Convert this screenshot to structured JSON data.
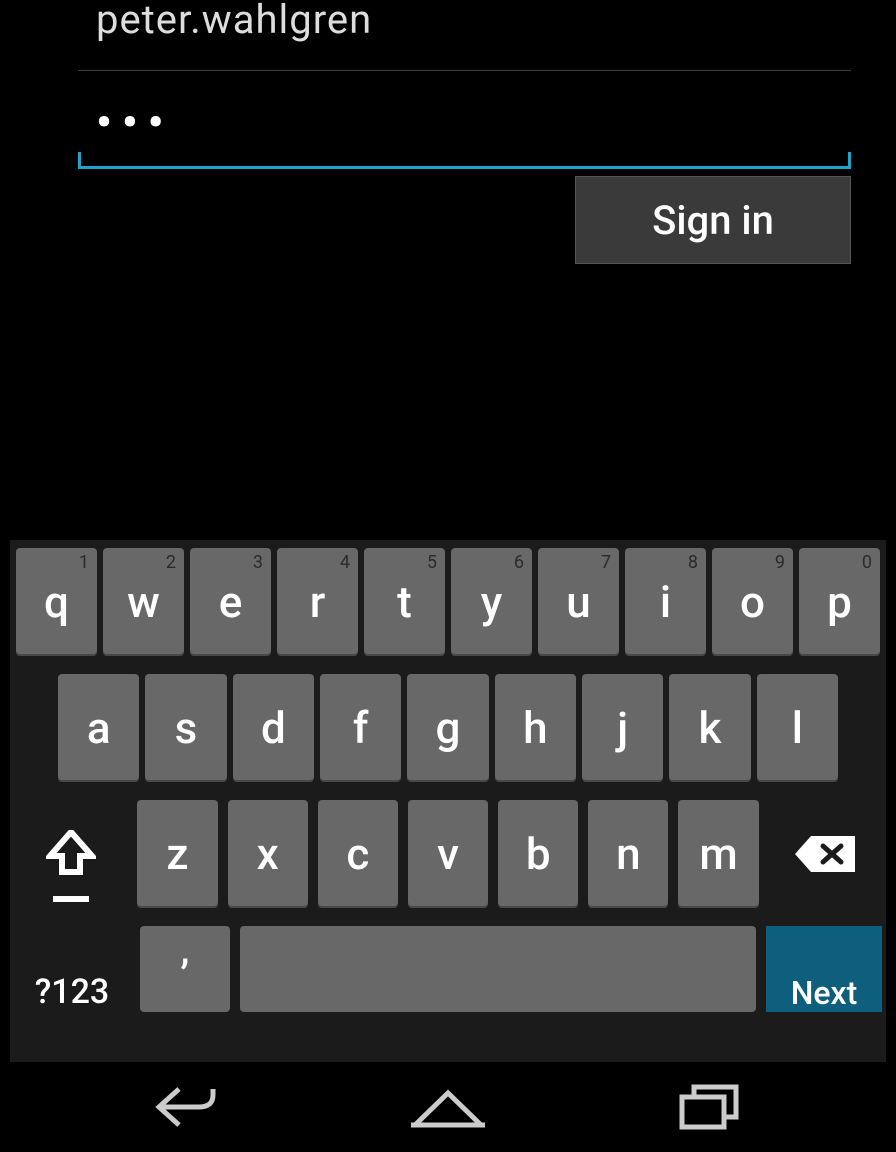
{
  "form": {
    "username_value": "peter.wahlgren",
    "password_masked": "•••",
    "signin_label": "Sign in"
  },
  "keyboard": {
    "row1": [
      {
        "label": "q",
        "sup": "1"
      },
      {
        "label": "w",
        "sup": "2"
      },
      {
        "label": "e",
        "sup": "3"
      },
      {
        "label": "r",
        "sup": "4"
      },
      {
        "label": "t",
        "sup": "5"
      },
      {
        "label": "y",
        "sup": "6"
      },
      {
        "label": "u",
        "sup": "7"
      },
      {
        "label": "i",
        "sup": "8"
      },
      {
        "label": "o",
        "sup": "9"
      },
      {
        "label": "p",
        "sup": "0"
      }
    ],
    "row2": [
      {
        "label": "a"
      },
      {
        "label": "s"
      },
      {
        "label": "d"
      },
      {
        "label": "f"
      },
      {
        "label": "g"
      },
      {
        "label": "h"
      },
      {
        "label": "j"
      },
      {
        "label": "k"
      },
      {
        "label": "l"
      }
    ],
    "row3": [
      {
        "label": "z"
      },
      {
        "label": "x"
      },
      {
        "label": "c"
      },
      {
        "label": "v"
      },
      {
        "label": "b"
      },
      {
        "label": "n"
      },
      {
        "label": "m"
      }
    ],
    "symbols_label": "?123",
    "next_label": "Next",
    "comma_label": ","
  }
}
